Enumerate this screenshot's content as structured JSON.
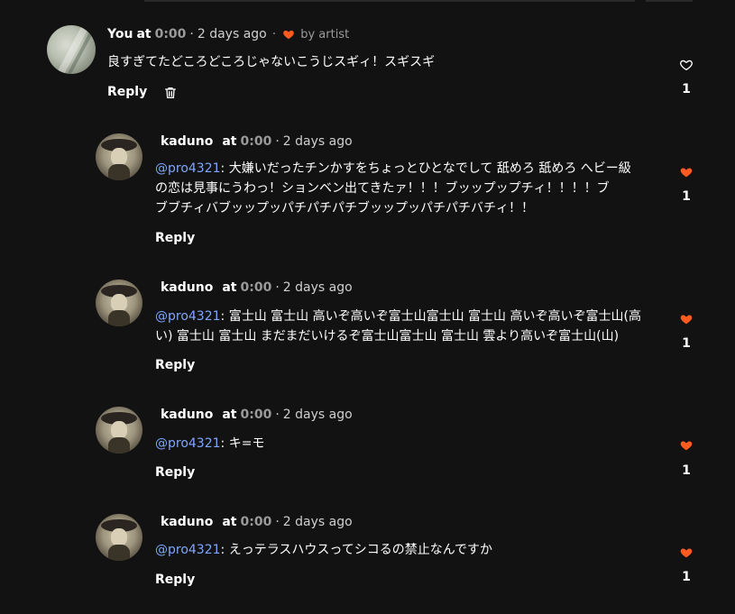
{
  "colors": {
    "background": "#121212",
    "accent_heart": "#ff5a1f",
    "mention": "#7ea6ff",
    "muted": "#9a9a9a"
  },
  "main_comment": {
    "author": "You",
    "at_label": "at",
    "time": "0:00",
    "separator": "·",
    "ago": "2 days ago",
    "dot": "·",
    "liked_by": "by artist",
    "text": "良すぎてたどころどころじゃないこうじスギィ！スギスギ",
    "reply_label": "Reply",
    "like_count": "1",
    "icons": [
      "heart-outline-icon",
      "trash-icon",
      "heart-filled-icon"
    ]
  },
  "replies": [
    {
      "author": "kaduno",
      "at_label": "at",
      "time": "0:00",
      "separator": "·",
      "ago": "2 days ago",
      "mention": "@pro4321",
      "lines": [
        ": 大嫌いだったチンかすをちょっとひとなでして 舐めろ 舐めろ へビー級",
        "の恋は見事にうわっ！ションベン出てきたァ！！！ブッップップチィ！！！！ブ",
        "ブブチィバブッップッパチパチパチブッップッパチパチバチィ！！"
      ],
      "reply_label": "Reply",
      "like_count": "1"
    },
    {
      "author": "kaduno",
      "at_label": "at",
      "time": "0:00",
      "separator": "·",
      "ago": "2 days ago",
      "mention": "@pro4321",
      "lines": [
        ": 富士山 富士山 高いぞ高いぞ富士山富士山 富士山 高いぞ高いぞ富士山(高",
        "い) 富士山 富士山 まだまだいけるぞ富士山富士山 富士山 雲より高いぞ富士山(山)"
      ],
      "reply_label": "Reply",
      "like_count": "1"
    },
    {
      "author": "kaduno",
      "at_label": "at",
      "time": "0:00",
      "separator": "·",
      "ago": "2 days ago",
      "mention": "@pro4321",
      "lines": [
        ": キ=モ"
      ],
      "reply_label": "Reply",
      "like_count": "1"
    },
    {
      "author": "kaduno",
      "at_label": "at",
      "time": "0:00",
      "separator": "·",
      "ago": "2 days ago",
      "mention": "@pro4321",
      "lines": [
        ": えっテラスハウスってシコるの禁止なんですか"
      ],
      "reply_label": "Reply",
      "like_count": "1"
    }
  ]
}
